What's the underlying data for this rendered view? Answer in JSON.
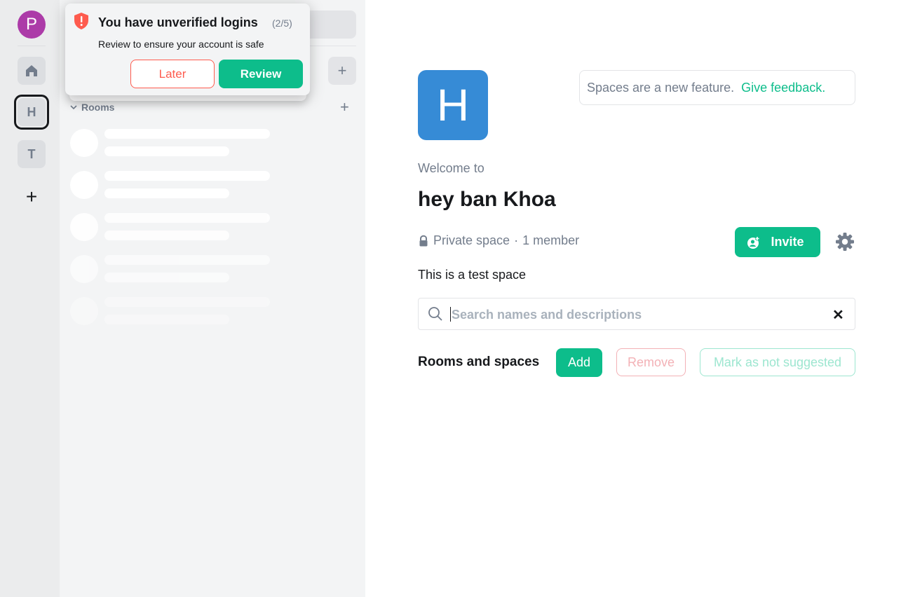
{
  "spacebar": {
    "user_initial": "P",
    "spaces": [
      {
        "initial": "H"
      },
      {
        "initial": "T"
      }
    ],
    "create_label": "+"
  },
  "roomlist": {
    "rooms_header": "Rooms",
    "add_room_label": "+",
    "explore_label": "+"
  },
  "toast": {
    "title": "You have unverified logins",
    "count": "(2/5)",
    "description": "Review to ensure your account is safe",
    "later_label": "Later",
    "review_label": "Review"
  },
  "space": {
    "avatar_initial": "H",
    "feedback_text": "Spaces are a new feature.",
    "feedback_link": "Give feedback.",
    "welcome": "Welcome to",
    "name": "hey ban Khoa",
    "privacy": "Private space",
    "separator": "·",
    "members": "1 member",
    "invite_label": "Invite",
    "topic": "This is a test space"
  },
  "hierarchy": {
    "search_placeholder": "Search names and descriptions",
    "clear_label": "✕",
    "section_label": "Rooms and spaces",
    "add_label": "Add",
    "remove_label": "Remove",
    "mark_label": "Mark as not suggested"
  },
  "colors": {
    "accent": "#0dbd8b",
    "alert": "#fe5b4e",
    "space_avatar": "#368bd6",
    "user_avatar": "#ac3ba8"
  }
}
